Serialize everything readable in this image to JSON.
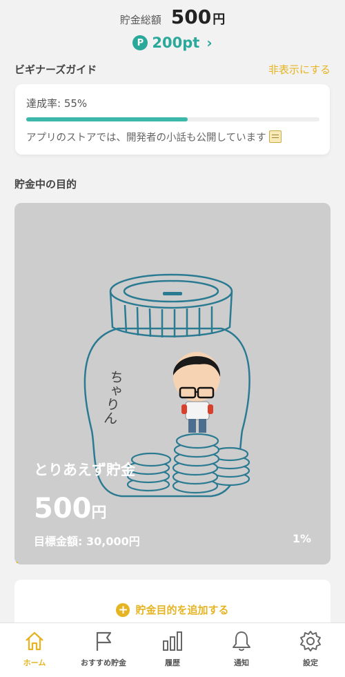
{
  "header": {
    "total_label": "貯金総額",
    "total_value": "500",
    "total_unit": "円",
    "points_badge": "P",
    "points_value": "200pt",
    "points_chevron": "›"
  },
  "guide": {
    "title": "ビギナーズガイド",
    "hide_label": "非表示にする",
    "rate_text": "達成率: 55%",
    "rate_fraction": 0.55,
    "message": "アプリのストアでは、開発者の小話も公開しています",
    "message_icon": "memo-icon"
  },
  "goals": {
    "title": "貯金中の目的",
    "card": {
      "jar_label": "ちゃりん",
      "name": "とりあえず貯金",
      "amount": "500",
      "amount_unit": "円",
      "target_text": "目標金額: 30,000円",
      "percent_text": "1%",
      "progress_fraction": 0.01
    }
  },
  "add_goal": {
    "icon": "plus-circle-icon",
    "label": "貯金目的を追加する"
  },
  "colors": {
    "accent": "#e6b422",
    "teal": "#2aa89a",
    "card_gray": "#cdcdcd"
  },
  "tabs": [
    {
      "label": "ホーム",
      "icon": "home-icon",
      "active": true
    },
    {
      "label": "おすすめ貯金",
      "icon": "flag-icon",
      "active": false
    },
    {
      "label": "履歴",
      "icon": "bar-chart-icon",
      "active": false
    },
    {
      "label": "通知",
      "icon": "bell-icon",
      "active": false
    },
    {
      "label": "設定",
      "icon": "gear-icon",
      "active": false
    }
  ]
}
